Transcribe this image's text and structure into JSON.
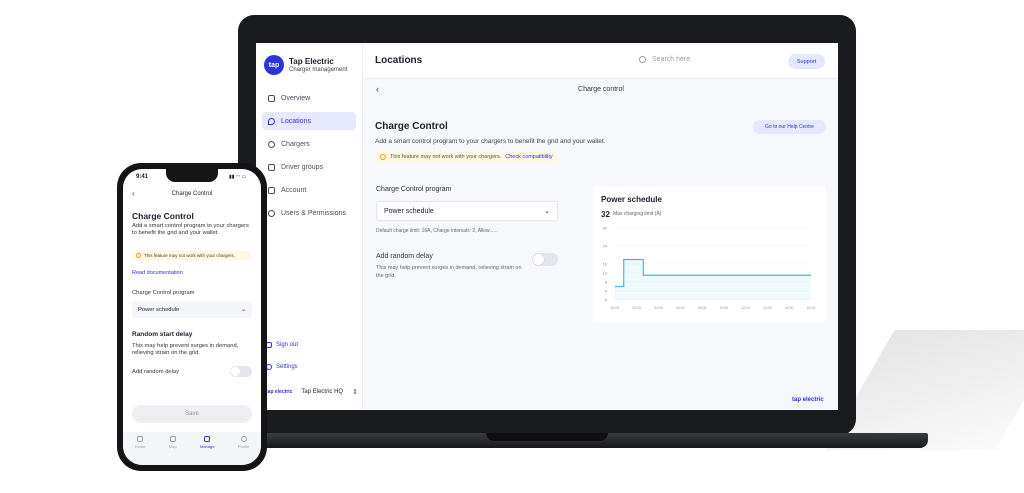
{
  "colors": {
    "accent": "#2b34d6",
    "accent_soft": "#e6e8fb",
    "chart_line": "#3fbfd6",
    "warning_bg": "#fff7e0"
  },
  "laptop": {
    "brand": {
      "logo": "tap",
      "title": "Tap Electric",
      "subtitle": "Charger management"
    },
    "sidebar": {
      "items": [
        {
          "label": "Overview",
          "icon": "bar-chart-icon"
        },
        {
          "label": "Locations",
          "icon": "location-pin-icon",
          "active": true
        },
        {
          "label": "Chargers",
          "icon": "charger-icon"
        },
        {
          "label": "Driver groups",
          "icon": "users-icon"
        },
        {
          "label": "Account",
          "icon": "account-card-icon"
        },
        {
          "label": "Users & Permissions",
          "icon": "user-icon"
        }
      ],
      "sign_out": "Sign out",
      "settings": "Settings",
      "org_logo": "tap electric",
      "org_name": "Tap Electric HQ"
    },
    "header": {
      "title": "Locations",
      "search_placeholder": "Search here",
      "support": "Support"
    },
    "subheader": {
      "title": "Charge control"
    },
    "content": {
      "title": "Charge Control",
      "help_button": "Go to our Help Centre",
      "description": "Add a smart control program to your chargers to benefit the grid and your wallet.",
      "warning": "This feature may not work with your chargers.",
      "warning_link": "Check compatibility",
      "program_label": "Charge Control program",
      "program_value": "Power schedule",
      "default_note": "Default charge limit: 16A, Charge intervals: 2, Allow......",
      "random_title": "Add random delay",
      "random_desc": "This may help prevent surges in demand, relieving strain on the grid."
    },
    "footer_logo": "tap electric"
  },
  "chart_data": {
    "type": "line",
    "title": "Power schedule",
    "max_value": "32",
    "max_label": "Max charging limit (A)",
    "y_ticks": [
      "32",
      "24",
      "16",
      "12",
      "8",
      "4",
      "0"
    ],
    "x_ticks": [
      "00:00",
      "02:00",
      "04:00",
      "06:00",
      "08:00",
      "10:00",
      "12:00",
      "14:00",
      "16:00",
      "18:00"
    ],
    "x": [
      0,
      0.4,
      0.4,
      1.3,
      1.3,
      9
    ],
    "y": [
      6,
      6,
      18,
      18,
      11,
      11
    ],
    "ylim": [
      0,
      32
    ],
    "grid": true
  },
  "phone": {
    "time": "9:41",
    "status": "▮▮ ◠ ▭",
    "subtitle": "Charge Control",
    "title": "Charge Control",
    "description": "Add a smart control program to your chargers to benefit the grid and your wallet.",
    "warning": "This feature may not work with your chargers.",
    "read_docs": "Read documentation",
    "program_label": "Charge Control program",
    "program_value": "Power schedule",
    "random_title": "Random start delay",
    "random_desc": "This may help prevent surges in demand, relieving strain on the grid.",
    "random_label": "Add random delay",
    "save": "Save",
    "tabs": [
      {
        "label": "Home",
        "icon": "home-icon"
      },
      {
        "label": "Map",
        "icon": "map-icon"
      },
      {
        "label": "Manage",
        "icon": "manage-icon",
        "active": true
      },
      {
        "label": "Profile",
        "icon": "profile-icon"
      }
    ]
  }
}
